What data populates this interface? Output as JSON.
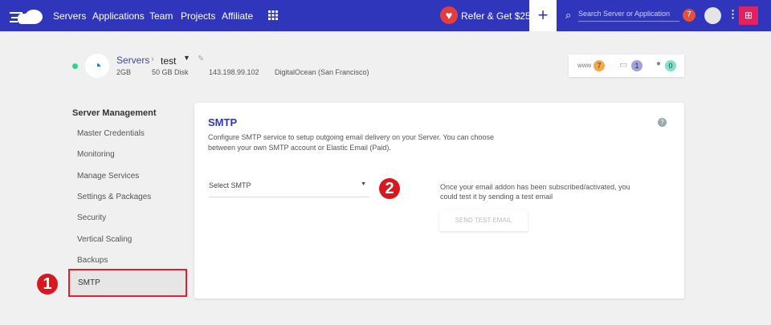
{
  "nav": {
    "items": [
      "Servers",
      "Applications",
      "Team",
      "Projects",
      "Affiliate"
    ],
    "refer": "Refer & Get $25",
    "search_placeholder": "Search Server or Application",
    "notifications": "7"
  },
  "server": {
    "breadcrumb": "Servers",
    "name": "test",
    "ram": "2GB",
    "disk": "50 GB Disk",
    "ip": "143.198.99.102",
    "provider": "DigitalOcean (San Francisco)"
  },
  "stats": {
    "www_label": "www",
    "apps": "7",
    "folders": "1",
    "users": "0"
  },
  "sidebar": {
    "title": "Server Management",
    "items": [
      "Master Credentials",
      "Monitoring",
      "Manage Services",
      "Settings & Packages",
      "Security",
      "Vertical Scaling",
      "Backups",
      "SMTP"
    ]
  },
  "smtp": {
    "title": "SMTP",
    "description_1": "Configure SMTP service to setup outgoing email delivery on your Server. You can choose",
    "description_2": "between your own SMTP account or Elastic Email (Paid).",
    "select_value": "Select SMTP",
    "info_1": "Once your email addon has been subscribed/activated, you",
    "info_2": "could test it by sending a test email",
    "send_button": "SEND TEST EMAIL"
  },
  "annotations": {
    "one": "1",
    "two": "2"
  }
}
